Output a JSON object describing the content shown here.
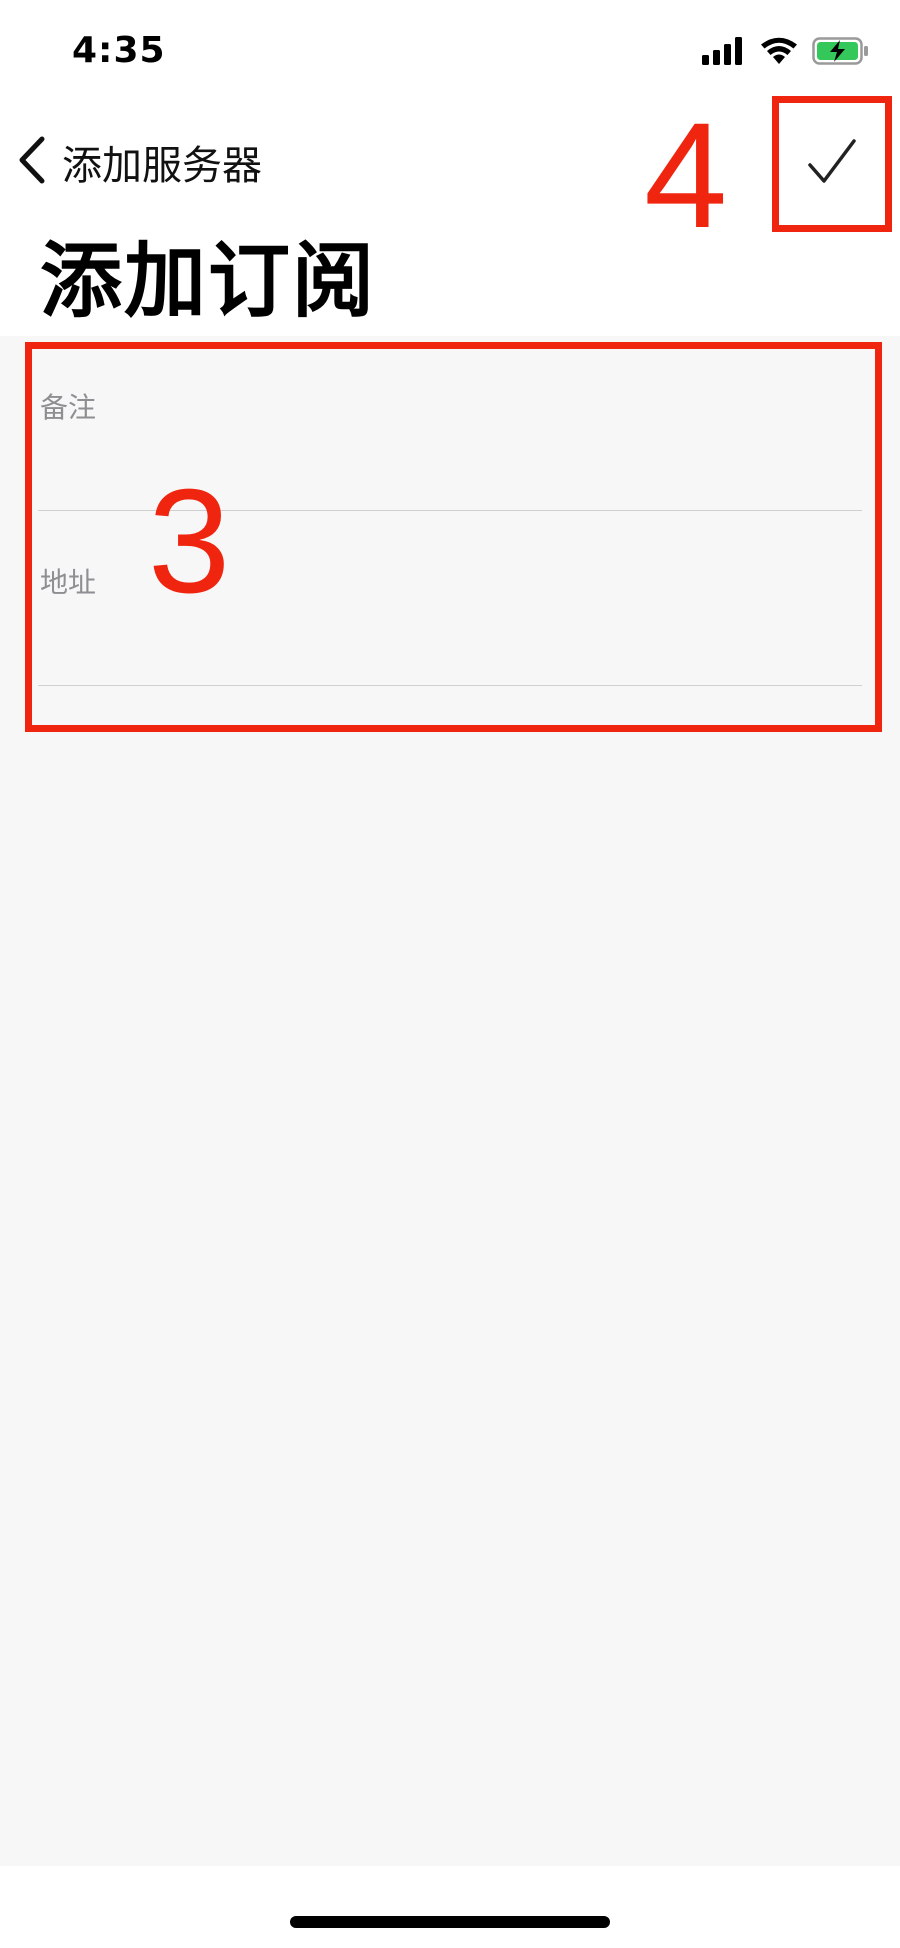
{
  "status_bar": {
    "time": "4:35",
    "icons": [
      "cellular-signal-icon",
      "wifi-icon",
      "battery-charging-icon"
    ],
    "battery_color": "#34c759"
  },
  "nav": {
    "back_label": "添加服务器",
    "confirm_icon": "checkmark-icon"
  },
  "page": {
    "title": "添加订阅"
  },
  "form": {
    "fields": [
      {
        "label": "备注",
        "value": "",
        "placeholder": ""
      },
      {
        "label": "地址",
        "value": "",
        "placeholder": ""
      }
    ]
  },
  "annotations": {
    "form_marker": "3",
    "confirm_marker": "4",
    "color": "#f0250f"
  }
}
